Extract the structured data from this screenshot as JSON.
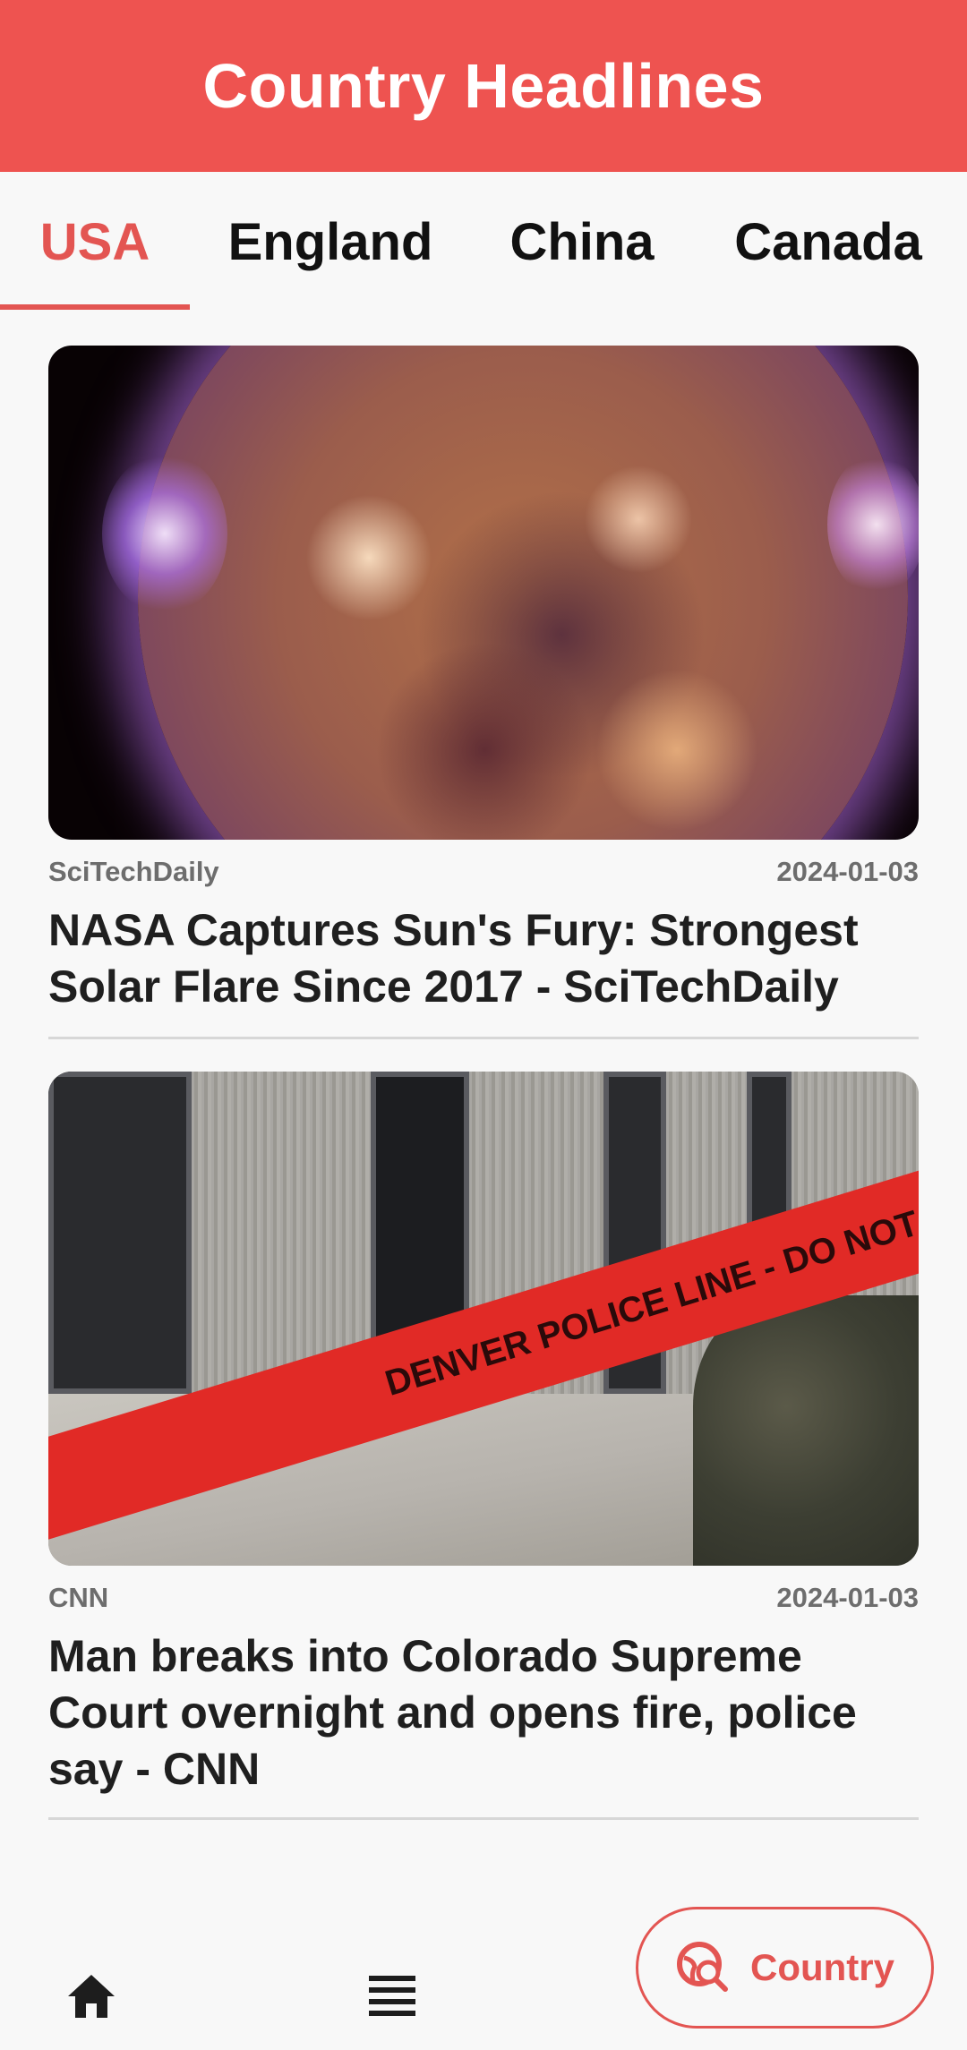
{
  "header": {
    "title": "Country Headlines",
    "background_color": "#ee5350"
  },
  "tabs": [
    {
      "label": "USA",
      "active": true
    },
    {
      "label": "England",
      "active": false
    },
    {
      "label": "China",
      "active": false
    },
    {
      "label": "Canada",
      "active": false
    }
  ],
  "accent_color": "#e35552",
  "articles": [
    {
      "source": "SciTechDaily",
      "date": "2024-01-03",
      "title": "NASA Captures Sun's Fury: Strongest Solar Flare Since 2017 - SciTechDaily",
      "image": "solar-flare-photo"
    },
    {
      "source": "CNN",
      "date": "2024-01-03",
      "title": "Man breaks into Colorado Supreme Court overnight and opens fire, police say - CNN",
      "image": "police-tape-building-photo",
      "image_text": "DENVER POLICE LINE - DO NOT CROSS"
    }
  ],
  "bottom_nav": {
    "home_icon": "home-icon",
    "list_icon": "list-icon",
    "country_label": "Country",
    "country_icon": "globe-search-icon"
  }
}
